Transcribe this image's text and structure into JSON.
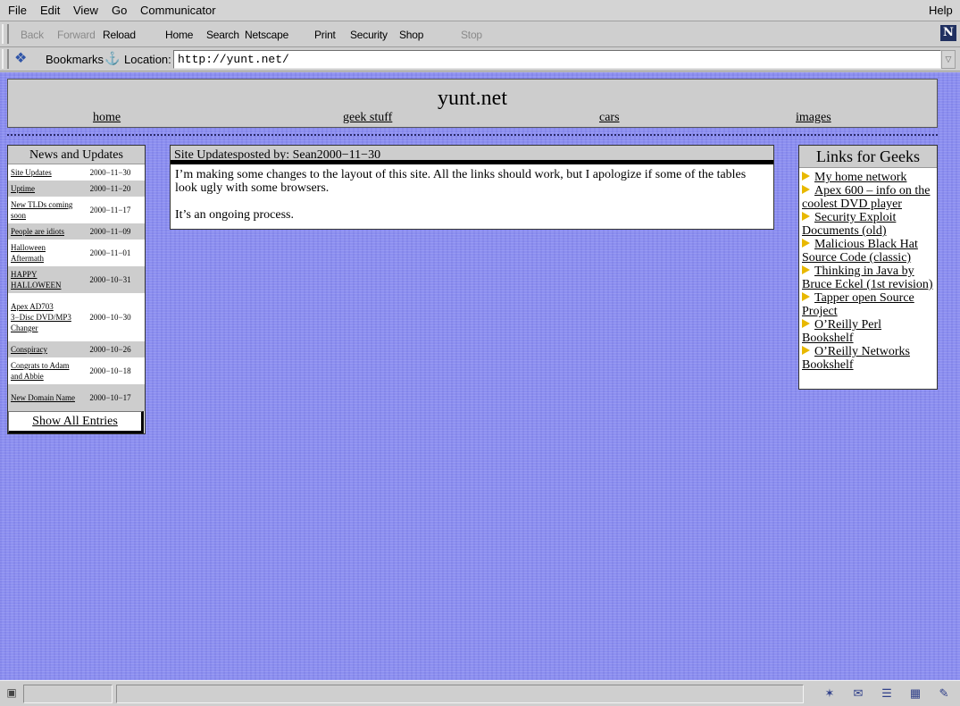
{
  "menu": {
    "file": "File",
    "edit": "Edit",
    "view": "View",
    "go": "Go",
    "communicator": "Communicator",
    "help": "Help"
  },
  "toolbar": {
    "back": "Back",
    "forward": "Forward",
    "reload": "Reload",
    "home": "Home",
    "search": "Search",
    "netscape": "Netscape",
    "print": "Print",
    "security": "Security",
    "shop": "Shop",
    "stop": "Stop"
  },
  "location": {
    "bookmarks_label": "Bookmarks",
    "location_label": "Location:",
    "url": "http://yunt.net/"
  },
  "header": {
    "title": "yunt.net",
    "nav": [
      "home",
      "geek stuff",
      "cars",
      "images"
    ]
  },
  "news": {
    "title": "News and Updates",
    "items": [
      {
        "title": "Site Updates",
        "date": "2000−11−30"
      },
      {
        "title": "Uptime",
        "date": "2000−11−20"
      },
      {
        "title": "New TLDs coming soon",
        "date": "2000−11−17"
      },
      {
        "title": "People are idiots",
        "date": "2000−11−09"
      },
      {
        "title": "Halloween Aftermath",
        "date": "2000−11−01"
      },
      {
        "title": "HAPPY HALLOWEEN",
        "date": "2000−10−31"
      },
      {
        "title": "Apex AD703 3−Disc DVD/MP3 Changer",
        "date": "2000−10−30"
      },
      {
        "title": "Conspiracy",
        "date": "2000−10−26"
      },
      {
        "title": "Congrats to Adam and Abbie",
        "date": "2000−10−18"
      },
      {
        "title": "New Domain Name",
        "date": "2000−10−17"
      }
    ],
    "show_all": "Show All Entries"
  },
  "post": {
    "heading": "Site Updatesposted by: Sean2000−11−30",
    "paragraphs": [
      "I’m making some changes to the layout of this site. All the links should work, but I apologize if some of the tables look ugly with some browsers.",
      "It’s an ongoing process."
    ]
  },
  "links": {
    "title": "Links for Geeks",
    "items": [
      "My home network",
      "Apex 600 – info on the coolest DVD player",
      "Security Exploit Documents (old)",
      "Malicious Black Hat Source Code (classic)",
      "Thinking in Java by Bruce Eckel (1st revision)",
      "Tapper open Source Project",
      "O’Reilly Perl Bookshelf",
      "O’Reilly Networks Bookshelf"
    ]
  },
  "icons": {
    "netscape": "netscape-n-icon",
    "bookmarks": "bookmarks-icon",
    "location": "location-icon",
    "link_bullet": "yellow-arrow-icon",
    "status_lock": "security-lock-icon"
  },
  "colors": {
    "page_background": "#8c8ff0",
    "panel_header": "#cdcdcd",
    "bullet": "#e8b800"
  }
}
